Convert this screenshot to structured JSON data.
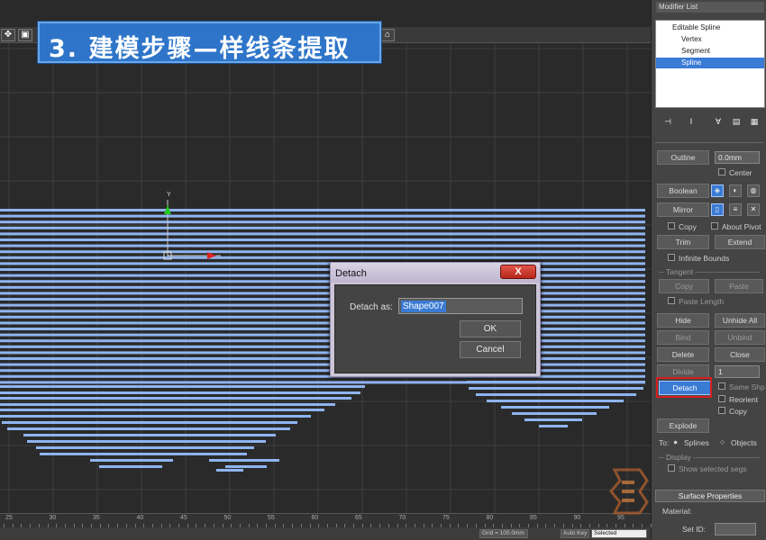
{
  "title_banner": {
    "text": "3. 建模步骤—样线条提取"
  },
  "dialog": {
    "title": "Detach",
    "close_label": "X",
    "detach_as_label": "Detach as:",
    "detach_as_value": "Shape007",
    "ok_label": "OK",
    "cancel_label": "Cancel"
  },
  "panel": {
    "modifier_list": "Modifier List",
    "stack": {
      "items": [
        "Editable Spline",
        "Vertex",
        "Segment",
        "Spline"
      ],
      "selected": "Spline"
    },
    "outline_label": "Outline",
    "outline_value": "0.0mm",
    "center_label": "Center",
    "boolean_label": "Boolean",
    "mirror_label": "Mirror",
    "copy_label": "Copy",
    "about_pivot_label": "About Pivot",
    "trim_label": "Trim",
    "extend_label": "Extend",
    "infinite_bounds_label": "Infinite Bounds",
    "tangent_label": "Tangent",
    "tangent_copy_label": "Copy",
    "paste_label": "Paste",
    "paste_length_label": "Paste Length",
    "hide_label": "Hide",
    "unhide_all_label": "Unhide All",
    "bind_label": "Bind",
    "unbind_label": "Unbind",
    "delete_label": "Delete",
    "close_label": "Close",
    "divide_label": "Divide",
    "divide_value": "1",
    "detach_label": "Detach",
    "same_shp_label": "Same Shp",
    "reorient_label": "Reorient",
    "detach_copy_label": "Copy",
    "explode_label": "Explode",
    "to_label": "To:",
    "splines_label": "Splines",
    "objects_label": "Objects",
    "display_label": "Display",
    "show_selected_segs_label": "Show selected segs",
    "surface_properties_label": "Surface Properties",
    "material_label": "Material:",
    "set_id_label": "Set ID:"
  },
  "timeline": {
    "ticks": [
      "25",
      "30",
      "35",
      "40",
      "45",
      "50",
      "55",
      "60",
      "65",
      "70",
      "75",
      "80",
      "85",
      "90",
      "95"
    ]
  },
  "status_bar": {
    "grid_label": "Grid = 100.0mm",
    "auto_key_label": "Auto Key",
    "selected_label": "Selected"
  },
  "gizmo": {
    "y_label": "Y"
  },
  "colors": {
    "spline": "#8fb4f0",
    "banner": "#2e75c9",
    "highlight": "#d81e1e",
    "selection": "#3a7bd5"
  }
}
